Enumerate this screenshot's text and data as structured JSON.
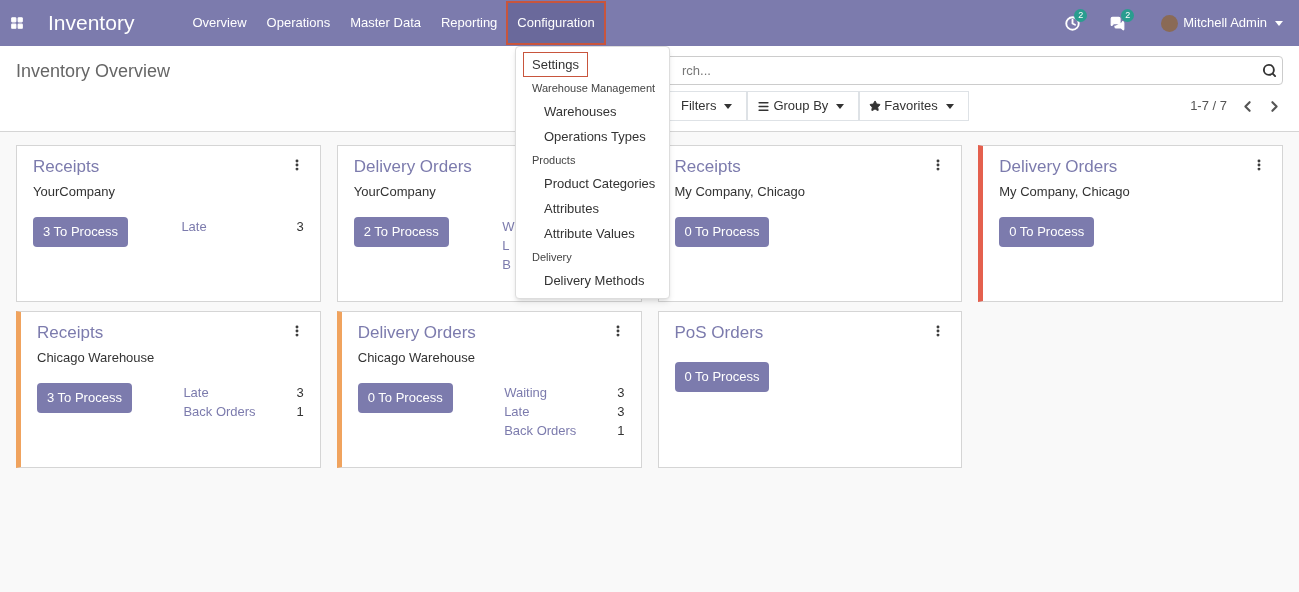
{
  "navbar": {
    "app": "Inventory",
    "menus": [
      {
        "label": "Overview",
        "selected": false
      },
      {
        "label": "Operations",
        "selected": false
      },
      {
        "label": "Master Data",
        "selected": false
      },
      {
        "label": "Reporting",
        "selected": false
      },
      {
        "label": "Configuration",
        "selected": true
      }
    ],
    "activity_count": "2",
    "message_count": "2",
    "user": "Mitchell Admin"
  },
  "control_panel": {
    "title": "Inventory Overview",
    "search": {
      "placeholder": "rch..."
    },
    "filters": [
      "Filters",
      "Group By",
      "Favorites"
    ],
    "pager": "1-7 / 7"
  },
  "dropdown": [
    {
      "kind": "item",
      "label": "Settings",
      "selected": true
    },
    {
      "kind": "header",
      "label": "Warehouse Management"
    },
    {
      "kind": "item",
      "label": "Warehouses",
      "selected": false
    },
    {
      "kind": "item",
      "label": "Operations Types",
      "selected": false
    },
    {
      "kind": "header",
      "label": "Products"
    },
    {
      "kind": "item",
      "label": "Product Categories",
      "selected": false
    },
    {
      "kind": "item",
      "label": "Attributes",
      "selected": false
    },
    {
      "kind": "item",
      "label": "Attribute Values",
      "selected": false
    },
    {
      "kind": "header",
      "label": "Delivery"
    },
    {
      "kind": "item",
      "label": "Delivery Methods",
      "selected": false
    }
  ],
  "cards": [
    {
      "title": "Receipts",
      "menu": true,
      "subtitle": "YourCompany",
      "button": "3 To Process",
      "stats": [
        {
          "label": "Late",
          "count": "3"
        }
      ]
    },
    {
      "title": "Delivery Orders",
      "subtitle": "YourCompany",
      "button": "2 To Process",
      "stats": [
        {
          "label": "W"
        },
        {
          "label": "L"
        },
        {
          "label": "B"
        }
      ]
    },
    {
      "title": "Receipts",
      "menu": true,
      "subtitle": "My Company, Chicago",
      "button": "0 To Process"
    },
    {
      "title": "Delivery Orders",
      "menu": true,
      "subtitle": "My Company, Chicago",
      "button": "0 To Process",
      "color": "#e4604e"
    },
    {
      "title": "Receipts",
      "menu": true,
      "subtitle": "Chicago Warehouse",
      "button": "3 To Process",
      "color": "#f0a35e",
      "stats": [
        {
          "label": "Late",
          "count": "3"
        },
        {
          "label": "Back Orders",
          "count": "1"
        }
      ]
    },
    {
      "title": "Delivery Orders",
      "menu": true,
      "subtitle": "Chicago Warehouse",
      "button": "0 To Process",
      "color": "#f0a35e",
      "stats": [
        {
          "label": "Waiting",
          "count": "3"
        },
        {
          "label": "Late",
          "count": "3"
        },
        {
          "label": "Back Orders",
          "count": "1"
        }
      ]
    },
    {
      "title": "PoS Orders",
      "menu": true,
      "button": "0 To Process"
    }
  ]
}
